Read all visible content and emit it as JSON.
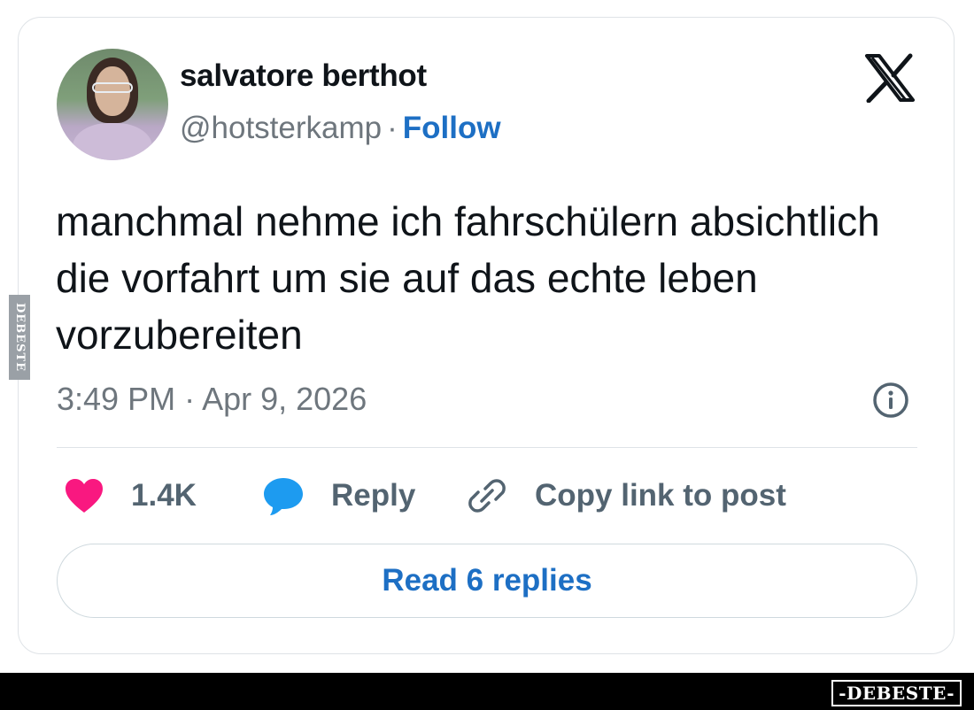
{
  "post": {
    "author_name": "salvatore berthot",
    "handle": "@hotsterkamp",
    "separator": "·",
    "follow_label": "Follow",
    "text": "manchmal nehme ich fahrschülern absichtlich die vorfahrt um sie auf das echte leben vorzubereiten",
    "timestamp": "3:49 PM · Apr 9, 2026"
  },
  "actions": {
    "like_count": "1.4K",
    "reply_label": "Reply",
    "copy_link_label": "Copy link to post",
    "read_replies_label": "Read 6 replies"
  },
  "watermarks": {
    "side": "DEBESTE",
    "footer": "-DEBESTE-"
  },
  "icons": [
    "x-logo-icon",
    "info-icon",
    "heart-icon",
    "reply-bubble-icon",
    "link-icon"
  ],
  "colors": {
    "follow": "#1d6fc4",
    "like": "#f91880",
    "reply": "#1d9bf0",
    "muted": "#6e767d"
  }
}
